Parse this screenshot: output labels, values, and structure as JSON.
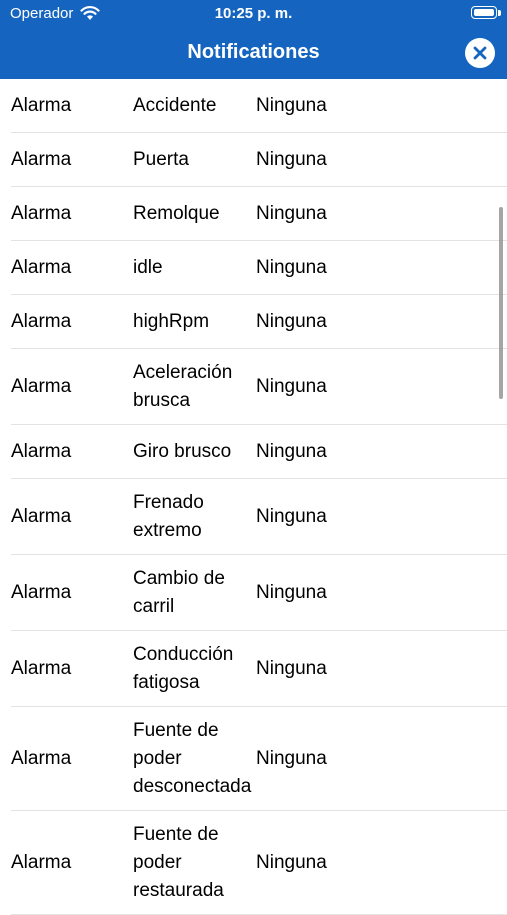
{
  "status_bar": {
    "carrier": "Operador",
    "time": "10:25 p. m.",
    "wifi_icon": "wifi-icon",
    "battery_icon": "battery-icon"
  },
  "nav": {
    "title": "Notificationes",
    "close_icon": "close-icon"
  },
  "colors": {
    "header_bg": "#1565c0",
    "separator": "#e3e3e3"
  },
  "rows": [
    {
      "type": "Alarma",
      "event": "Accidente",
      "value": "Ninguna"
    },
    {
      "type": "Alarma",
      "event": "Puerta",
      "value": "Ninguna"
    },
    {
      "type": "Alarma",
      "event": "Remolque",
      "value": "Ninguna"
    },
    {
      "type": "Alarma",
      "event": "idle",
      "value": "Ninguna"
    },
    {
      "type": "Alarma",
      "event": "highRpm",
      "value": "Ninguna"
    },
    {
      "type": "Alarma",
      "event": "Aceleración brusca",
      "value": "Ninguna"
    },
    {
      "type": "Alarma",
      "event": "Giro brusco",
      "value": "Ninguna"
    },
    {
      "type": "Alarma",
      "event": "Frenado extremo",
      "value": "Ninguna"
    },
    {
      "type": "Alarma",
      "event": "Cambio de carril",
      "value": "Ninguna"
    },
    {
      "type": "Alarma",
      "event": "Conducción fatigosa",
      "value": "Ninguna"
    },
    {
      "type": "Alarma",
      "event": "Fuente de poder desconectada",
      "value": "Ninguna"
    },
    {
      "type": "Alarma",
      "event": "Fuente de poder restaurada",
      "value": "Ninguna"
    }
  ]
}
